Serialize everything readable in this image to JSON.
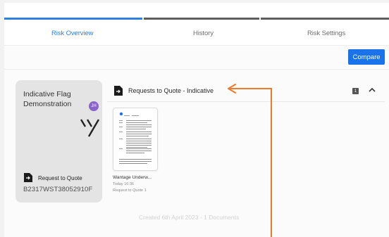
{
  "tabs": [
    {
      "label": "Risk Overview",
      "active": true
    },
    {
      "label": "History",
      "active": false
    },
    {
      "label": "Risk Settings",
      "active": false
    }
  ],
  "toolbar": {
    "compare_label": "Compare"
  },
  "card": {
    "title_line1": "Indicative Flag",
    "title_line2": "Demonstration",
    "avatar_initials": "JH",
    "request_label": "Request to Quote",
    "code": "B2317WST38052910F"
  },
  "section": {
    "title": "Requests to Quote - Indicative",
    "count": "1"
  },
  "document": {
    "name": "Wantage Underw...",
    "date": "Today 16:36",
    "request": "Request to Quote 1"
  },
  "footer": {
    "created_text": "Created 6th April 2023 - 1 Documents"
  },
  "colors": {
    "accent": "#1a73e8",
    "arrow": "#f07a2a",
    "avatar": "#8a63c9"
  }
}
